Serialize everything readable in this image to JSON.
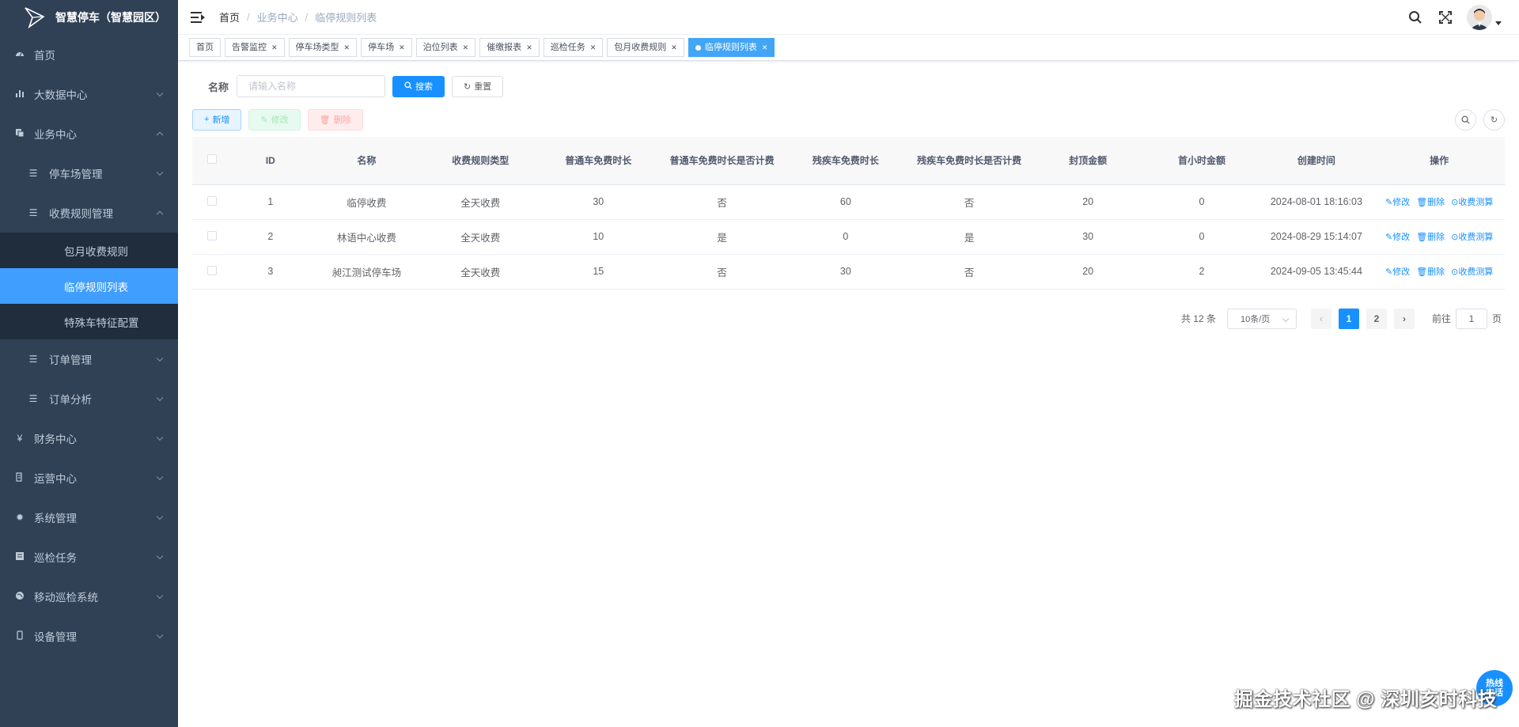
{
  "app": {
    "title": "智慧停车（智慧园区）"
  },
  "sidebar": {
    "items": [
      {
        "label": "首页",
        "icon": "dashboard-icon"
      },
      {
        "label": "大数据中心",
        "icon": "bar-chart-icon"
      },
      {
        "label": "业务中心",
        "icon": "copy-icon"
      },
      {
        "label": "停车场管理",
        "icon": "list-icon"
      },
      {
        "label": "收费规则管理",
        "icon": "list-icon"
      },
      {
        "label": "包月收费规则"
      },
      {
        "label": "临停规则列表"
      },
      {
        "label": "特殊车特征配置"
      },
      {
        "label": "订单管理",
        "icon": "list-icon"
      },
      {
        "label": "订单分析",
        "icon": "list-icon"
      },
      {
        "label": "财务中心",
        "icon": "yen-icon"
      },
      {
        "label": "运营中心",
        "icon": "clipboard-icon"
      },
      {
        "label": "系统管理",
        "icon": "gear-icon"
      },
      {
        "label": "巡检任务",
        "icon": "document-icon"
      },
      {
        "label": "移动巡检系统",
        "icon": "globe-icon"
      },
      {
        "label": "设备管理",
        "icon": "phone-icon"
      }
    ]
  },
  "breadcrumb": [
    "首页",
    "业务中心",
    "临停规则列表"
  ],
  "tags": [
    "首页",
    "告警监控",
    "停车场类型",
    "停车场",
    "泊位列表",
    "催缴报表",
    "巡检任务",
    "包月收费规则",
    "临停规则列表"
  ],
  "search": {
    "label": "名称",
    "placeholder": "请输入名称",
    "search_btn": "搜索",
    "reset_btn": "重置"
  },
  "toolbar": {
    "add": "新增",
    "edit": "修改",
    "delete": "删除"
  },
  "table": {
    "headers": [
      "ID",
      "名称",
      "收费规则类型",
      "普通车免费时长",
      "普通车免费时长是否计费",
      "残疾车免费时长",
      "残疾车免费时长是否计费",
      "封顶金额",
      "首小时金额",
      "创建时间",
      "操作"
    ],
    "rows": [
      [
        "1",
        "临停收费",
        "全天收费",
        "30",
        "否",
        "60",
        "否",
        "20",
        "0",
        "2024-08-01 18:16:03"
      ],
      [
        "2",
        "林语中心收费",
        "全天收费",
        "10",
        "是",
        "0",
        "是",
        "30",
        "0",
        "2024-08-29 15:14:07"
      ],
      [
        "3",
        "昶江测试停车场",
        "全天收费",
        "15",
        "否",
        "30",
        "否",
        "20",
        "2",
        "2024-09-05 13:45:44"
      ]
    ],
    "ops": {
      "edit": "修改",
      "delete": "删除",
      "calc": "收费测算"
    }
  },
  "pagination": {
    "total": "共 12 条",
    "page_size": "10条/页",
    "pages": [
      "1",
      "2"
    ],
    "goto_prefix": "前往",
    "goto_value": "1",
    "goto_suffix": "页"
  },
  "watermark": "掘金技术社区 @ 深圳亥时科技",
  "hotline": "热线\n电话",
  "colors": {
    "sidebar_bg": "#304156",
    "submenu_bg": "#1f2d3d",
    "primary": "#1890ff",
    "active_tag": "#42a5f5"
  }
}
